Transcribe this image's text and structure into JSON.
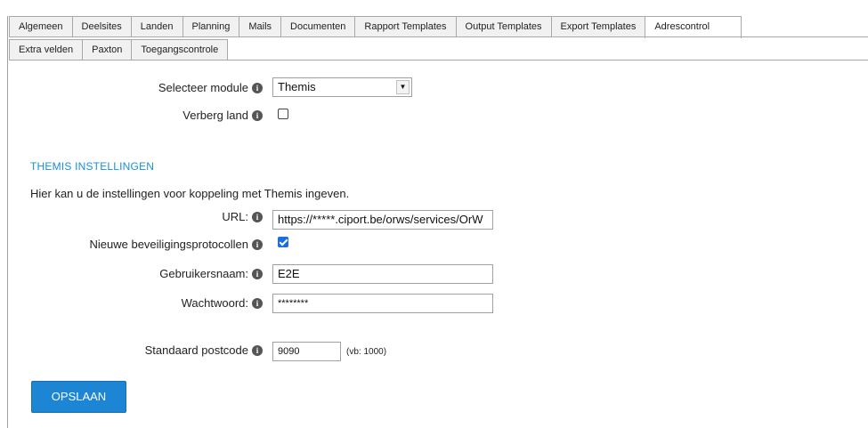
{
  "tabs_row1": [
    "Algemeen",
    "Deelsites",
    "Landen",
    "Planning",
    "Mails",
    "Documenten",
    "Rapport Templates",
    "Output Templates",
    "Export Templates",
    "Adrescontrol"
  ],
  "tabs_row2": [
    "Extra velden",
    "Paxton",
    "Toegangscontrole"
  ],
  "active_tab": "Adrescontrol",
  "module": {
    "label": "Selecteer module",
    "value": "Themis"
  },
  "hide_country": {
    "label": "Verberg land",
    "checked": false
  },
  "section": {
    "title": "THEMIS INSTELLINGEN",
    "description": "Hier kan u de instellingen voor koppeling met Themis ingeven."
  },
  "url": {
    "label": "URL:",
    "value": "https://*****.ciport.be/orws/services/OrW"
  },
  "protocols": {
    "label": "Nieuwe beveiligingsprotocollen",
    "checked": true
  },
  "username": {
    "label": "Gebruikersnaam:",
    "value": "E2E"
  },
  "password": {
    "label": "Wachtwoord:",
    "value": "********"
  },
  "postcode": {
    "label": "Standaard postcode",
    "value": "9090",
    "hint": "(vb: 1000)"
  },
  "save_button": "OPSLAAN",
  "info_glyph": "i",
  "colors": {
    "accent": "#1a8fd3",
    "button": "#1d86d4",
    "checkbox": "#1a6fe0"
  }
}
